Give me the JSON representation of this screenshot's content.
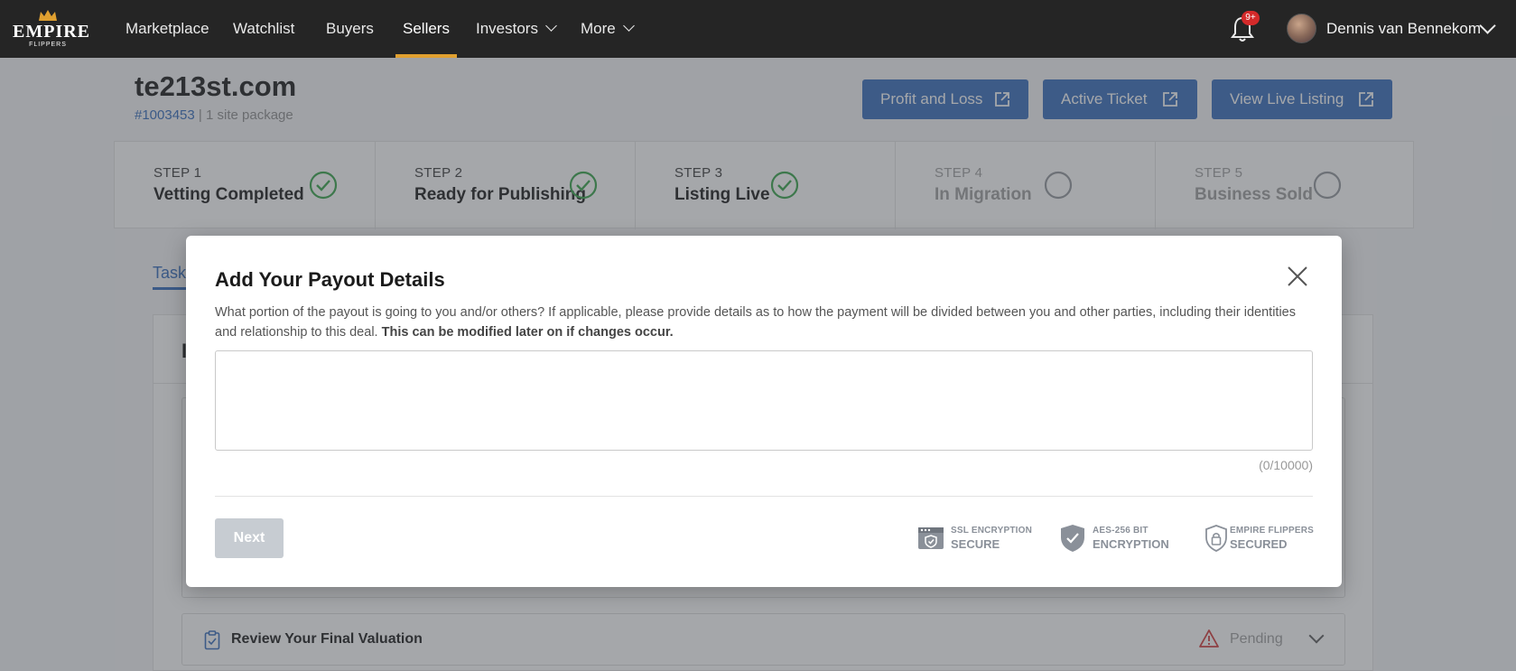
{
  "brand": {
    "logo_word": "EMPIRE",
    "logo_sub": "FLIPPERS",
    "accent": "#e0a030"
  },
  "nav": {
    "items": [
      {
        "label": "Marketplace"
      },
      {
        "label": "Watchlist"
      },
      {
        "label": "Buyers"
      },
      {
        "label": "Sellers",
        "active": true
      },
      {
        "label": "Investors",
        "dropdown": true
      },
      {
        "label": "More",
        "dropdown": true
      }
    ],
    "notification_badge": "9+",
    "user_name": "Dennis van Bennekom"
  },
  "listing": {
    "title": "te213st.com",
    "id": "#1003453",
    "package": "| 1 site package"
  },
  "actions": [
    {
      "label": "Profit and Loss",
      "icon": "external-link-icon"
    },
    {
      "label": "Active Ticket",
      "icon": "external-link-icon"
    },
    {
      "label": "View Live Listing",
      "icon": "external-link-icon"
    }
  ],
  "steps": [
    {
      "number": "STEP 1",
      "label": "Vetting Completed",
      "status": "complete"
    },
    {
      "number": "STEP 2",
      "label": "Ready for Publishing",
      "status": "complete"
    },
    {
      "number": "STEP 3",
      "label": "Listing Live",
      "status": "complete"
    },
    {
      "number": "STEP 4",
      "label": "In Migration",
      "status": "pending"
    },
    {
      "number": "STEP 5",
      "label": "Business Sold",
      "status": "pending"
    }
  ],
  "tabs": {
    "tasks": "Task"
  },
  "panel": {
    "heading_visible": "I"
  },
  "task": {
    "title": "Review Your Final Valuation",
    "status": "Pending"
  },
  "modal": {
    "title": "Add Your Payout Details",
    "description": "What portion of the payout is going to you and/or others? If applicable, please provide details as to how the payment will be divided between you and other parties, including their identities and relationship to this deal.",
    "description_bold": "This can be modified later on if changes occur.",
    "textarea_value": "",
    "char_count": "(0/10000)",
    "next_label": "Next",
    "badges": [
      {
        "small": "SSL ENCRYPTION",
        "big": "SECURE",
        "icon": "ssl-window-icon"
      },
      {
        "small": "AES-256 BIT",
        "big": "ENCRYPTION",
        "icon": "shield-check-icon"
      },
      {
        "small": "EMPIRE FLIPPERS",
        "big": "SECURED",
        "icon": "lock-shield-icon"
      }
    ]
  },
  "colors": {
    "primary": "#2f66b9",
    "success": "#2ea043",
    "warning": "#d03030",
    "nav_bg": "#252525"
  }
}
